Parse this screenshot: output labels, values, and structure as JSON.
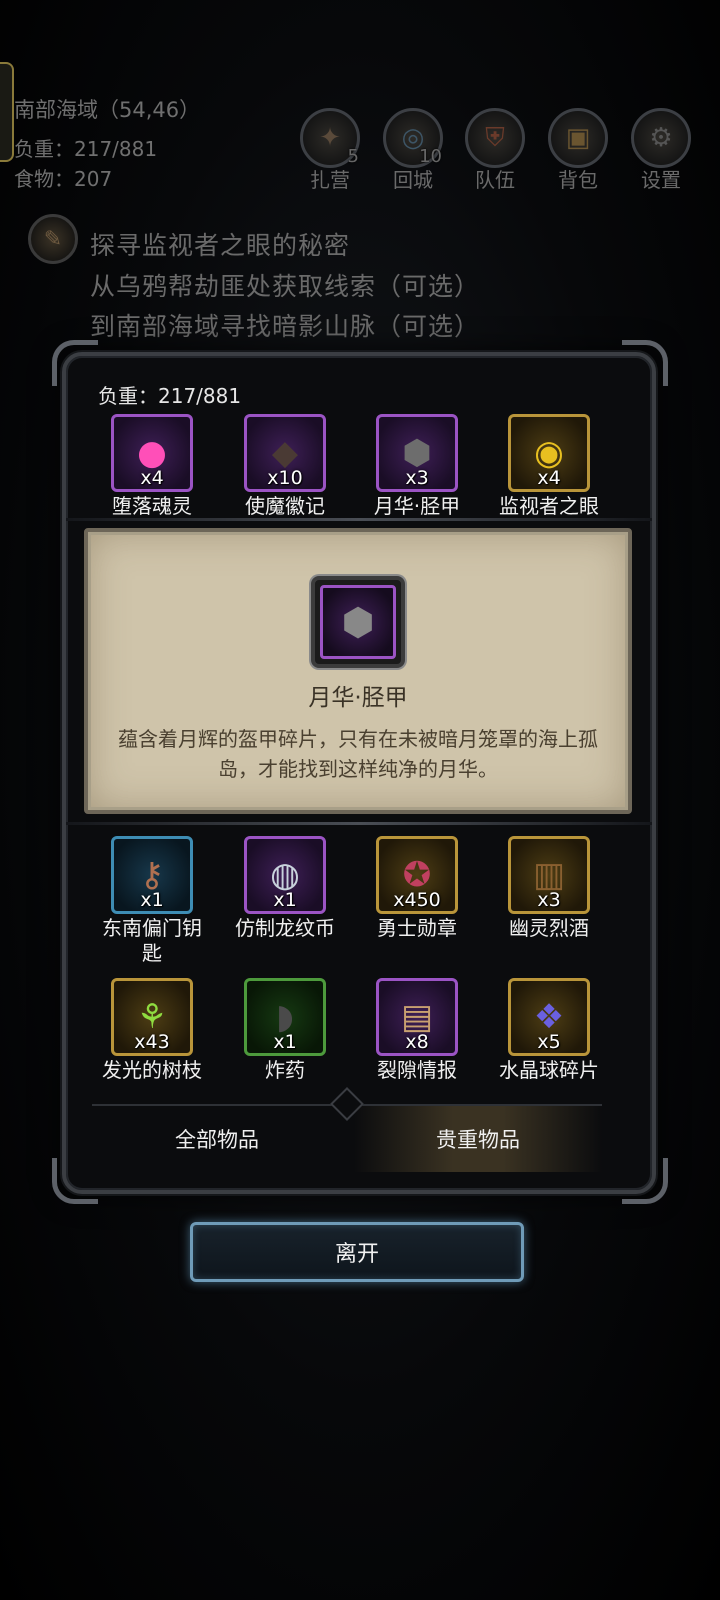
{
  "hud": {
    "location": "南部海域（54,46）",
    "weight": "负重：217/881",
    "food": "食物：207",
    "buttons": [
      {
        "label": "扎营",
        "count": "5",
        "icon": "campfire-icon"
      },
      {
        "label": "回城",
        "count": "10",
        "icon": "portal-icon"
      },
      {
        "label": "队伍",
        "count": "",
        "icon": "shield-icon"
      },
      {
        "label": "背包",
        "count": "",
        "icon": "backpack-icon"
      },
      {
        "label": "设置",
        "count": "",
        "icon": "gear-icon"
      }
    ],
    "quest": {
      "title": "探寻监视者之眼的秘密",
      "steps": [
        "从乌鸦帮劫匪处获取线索（可选）",
        "到南部海域寻找暗影山脉（可选）"
      ]
    }
  },
  "panel": {
    "weight": "负重：217/881",
    "items_top": [
      {
        "name": "堕落魂灵",
        "qty": "x4",
        "quality": "purple",
        "icon": "soul-orb-icon"
      },
      {
        "name": "使魔徽记",
        "qty": "x10",
        "quality": "purple",
        "icon": "dark-emblem-icon"
      },
      {
        "name": "月华·胫甲",
        "qty": "x3",
        "quality": "purple",
        "icon": "greave-icon"
      },
      {
        "name": "监视者之眼",
        "qty": "x4",
        "quality": "gold",
        "icon": "eye-icon"
      }
    ],
    "detail": {
      "name": "月华·胫甲",
      "description": "蕴含着月辉的盔甲碎片，只有在未被暗月笼罩的海上孤岛，才能找到这样纯净的月华。"
    },
    "items_bottom": [
      {
        "name": "东南偏门钥匙",
        "qty": "x1",
        "quality": "blue",
        "icon": "key-icon"
      },
      {
        "name": "仿制龙纹币",
        "qty": "x1",
        "quality": "purple",
        "icon": "coin-icon"
      },
      {
        "name": "勇士勋章",
        "qty": "x450",
        "quality": "gold",
        "icon": "medal-icon"
      },
      {
        "name": "幽灵烈酒",
        "qty": "x3",
        "quality": "gold",
        "icon": "barrel-icon"
      },
      {
        "name": "发光的树枝",
        "qty": "x43",
        "quality": "gold",
        "icon": "glowing-branch-icon"
      },
      {
        "name": "炸药",
        "qty": "x1",
        "quality": "green",
        "icon": "explosive-icon"
      },
      {
        "name": "裂隙情报",
        "qty": "x8",
        "quality": "purple",
        "icon": "scroll-icon"
      },
      {
        "name": "水晶球碎片",
        "qty": "x5",
        "quality": "gold",
        "icon": "crystal-icon"
      }
    ],
    "tabs": [
      {
        "label": "全部物品",
        "active": false
      },
      {
        "label": "贵重物品",
        "active": true
      }
    ]
  },
  "leave_button": "离开"
}
